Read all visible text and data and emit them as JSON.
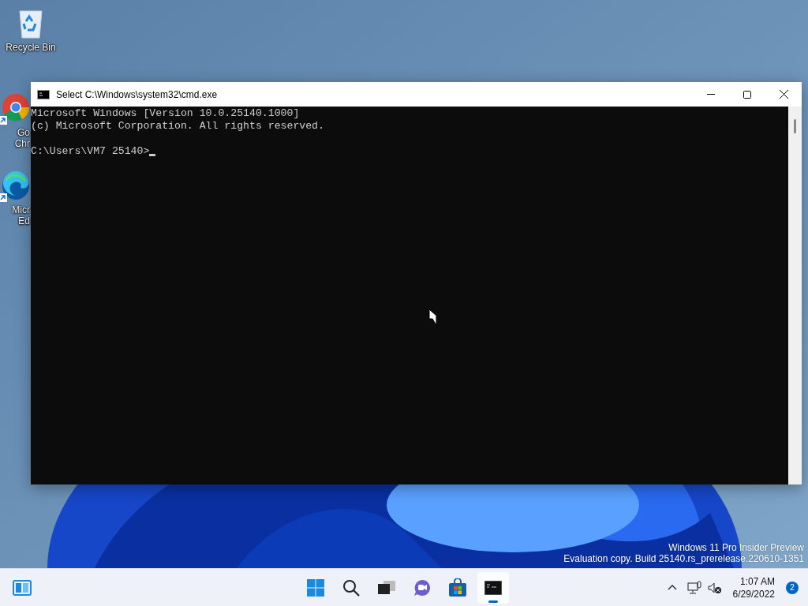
{
  "desktop": {
    "icons": [
      {
        "kind": "recycle-bin",
        "label": [
          "Recycle Bin"
        ],
        "shortcut": false
      },
      {
        "kind": "chrome",
        "label": [
          "Go",
          "Chr"
        ],
        "shortcut": true
      },
      {
        "kind": "edge",
        "label": [
          "Micr",
          "Ed"
        ],
        "shortcut": true
      }
    ],
    "watermark": [
      "Windows 11 Pro Insider Preview",
      "Evaluation copy. Build 25140.rs_prerelease.220610-1351"
    ]
  },
  "window": {
    "title": "Select C:\\Windows\\system32\\cmd.exe",
    "console_lines": [
      "Microsoft Windows [Version 10.0.25140.1000]",
      "(c) Microsoft Corporation. All rights reserved."
    ],
    "prompt": "C:\\Users\\VM7 25140>"
  },
  "taskbar": {
    "apps": [
      {
        "kind": "start",
        "running": false
      },
      {
        "kind": "search",
        "running": false
      },
      {
        "kind": "task-view",
        "running": false
      },
      {
        "kind": "chat",
        "running": false
      },
      {
        "kind": "store",
        "running": false
      },
      {
        "kind": "terminal",
        "running": true
      }
    ],
    "time": "1:07 AM",
    "date": "6/29/2022",
    "notifications": "2"
  }
}
